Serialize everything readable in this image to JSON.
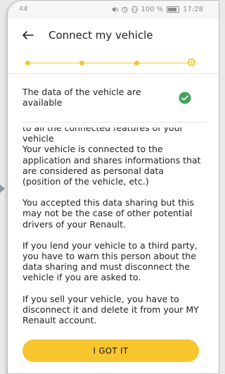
{
  "statusbar": {
    "signal": "4.ıll",
    "battery": "100 %",
    "time": "17:28",
    "icons": [
      "mute-icon",
      "alarm-icon",
      "vibrate-icon",
      "battery-icon"
    ]
  },
  "header": {
    "back_icon": "arrow-left-icon",
    "title": "Connect my vehicle"
  },
  "stepper": {
    "total_steps": 4,
    "current_step": 4
  },
  "status_row": {
    "text": "The data of the vehicle are available",
    "icon": "check-circle-icon"
  },
  "body": {
    "paragraph1": "to all the connected features of your vehicle\nYour vehicle is connected to the application and shares informations that are considered as personal data (position of the vehicle, etc.)",
    "paragraph2": "You accepted this data sharing but this may not be the case of other potential drivers of your Renault.",
    "paragraph3": "If you lend your vehicle to a third party, you have to warn this person about the data sharing and must disconnect the vehicle if you are asked to.",
    "paragraph4": "If you sell your vehicle, you have to disconnect it and delete it from your MY Renault account."
  },
  "button": {
    "label": "I GOT IT"
  },
  "colors": {
    "accent": "#f7c62e",
    "success": "#3fa45b",
    "text": "#222222"
  }
}
